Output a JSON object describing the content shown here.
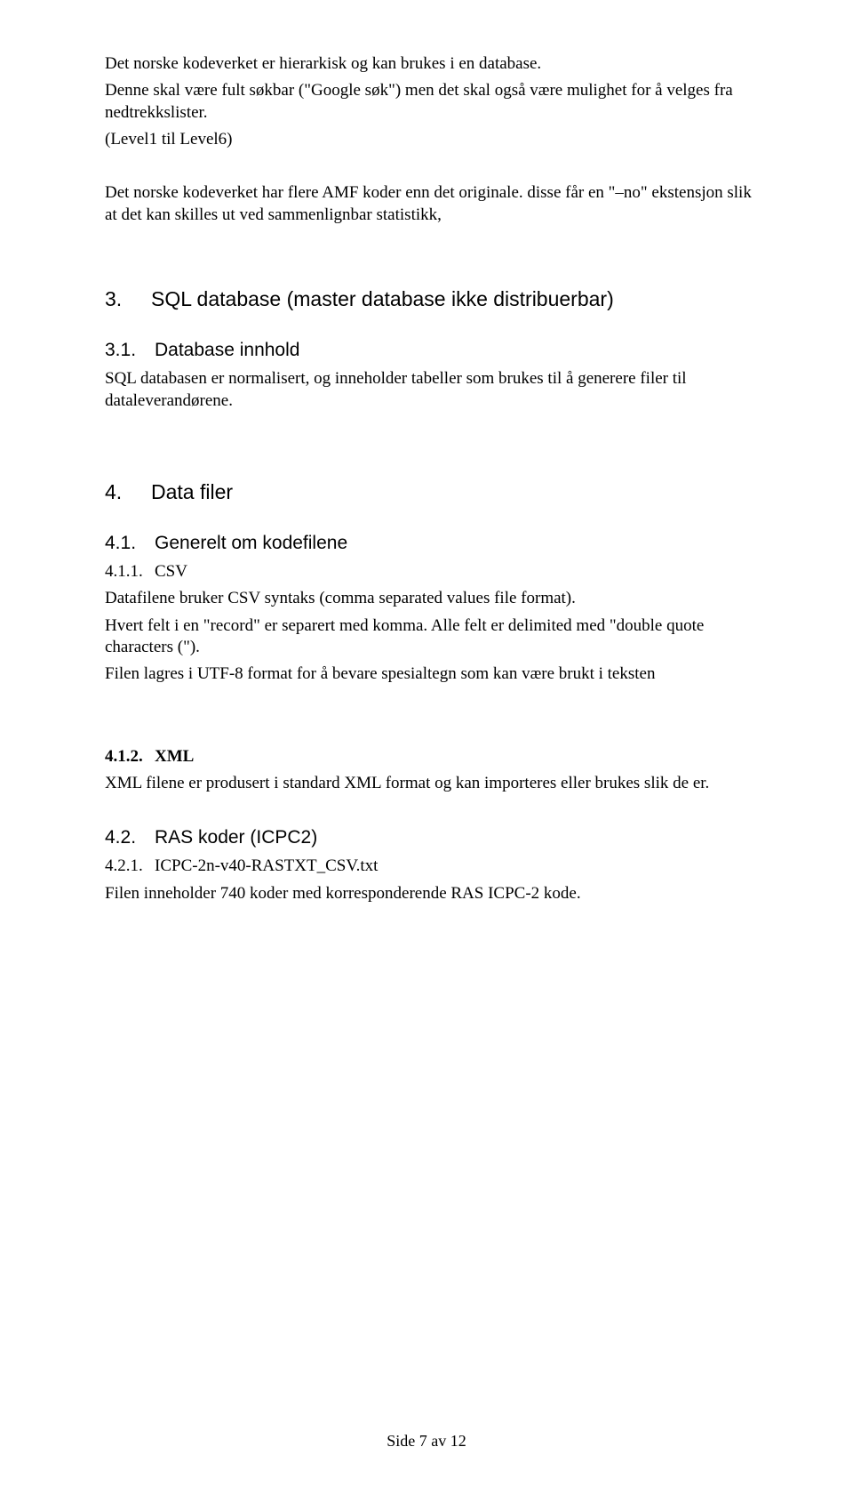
{
  "para1": "Det norske kodeverket er hierarkisk og kan brukes i en database.",
  "para2": "Denne skal være fult søkbar (\"Google søk\") men det skal også være mulighet for å velges fra nedtrekkslister.",
  "para3": "(Level1 til Level6)",
  "para4": "Det norske kodeverket har flere AMF koder enn det originale. disse får en \"–no\" ekstensjon slik at det kan skilles ut ved sammenlignbar statistikk,",
  "sec3": {
    "num": "3.",
    "title": "SQL database (master database ikke distribuerbar)"
  },
  "sec3_1": {
    "num": "3.1.",
    "title": "Database innhold"
  },
  "sec3_1_body": "SQL databasen er normalisert, og inneholder tabeller som brukes til å generere filer til dataleverandørene.",
  "sec4": {
    "num": "4.",
    "title": "Data filer"
  },
  "sec4_1": {
    "num": "4.1.",
    "title": "Generelt om kodefilene"
  },
  "sec4_1_1": {
    "num": "4.1.1.",
    "title": "CSV"
  },
  "sec4_1_1_body1": "Datafilene  bruker CSV syntaks (comma separated values file format).",
  "sec4_1_1_body2": "Hvert felt i en \"record\" er separert med komma. Alle felt er delimited med \"double quote characters (\").",
  "sec4_1_1_body3": "Filen lagres i UTF-8 format for å bevare spesialtegn som kan være brukt i teksten",
  "sec4_1_2": {
    "num": "4.1.2.",
    "title": "XML"
  },
  "sec4_1_2_body": "XML filene er produsert i standard XML format og kan importeres eller brukes slik de er.",
  "sec4_2": {
    "num": "4.2.",
    "title": "RAS koder (ICPC2)"
  },
  "sec4_2_1": {
    "num": "4.2.1.",
    "title": "ICPC-2n-v40-RASTXT_CSV.txt"
  },
  "sec4_2_1_body": "Filen inneholder 740 koder med korresponderende RAS ICPC-2 kode.",
  "footer": "Side 7 av 12"
}
